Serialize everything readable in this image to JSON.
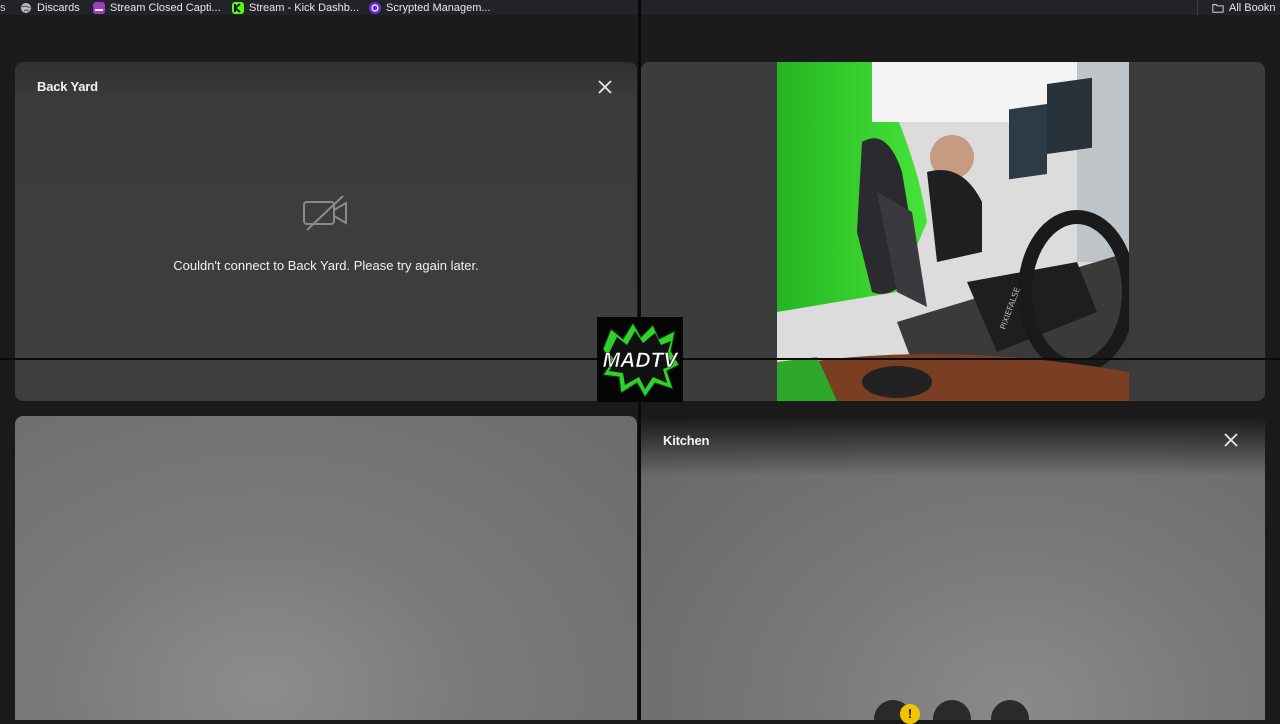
{
  "bookmarks": {
    "items": [
      {
        "label": "Discards",
        "icon": "globe-icon"
      },
      {
        "label": "Stream Closed Capti...",
        "icon": "captions-icon"
      },
      {
        "label": "Stream - Kick Dashb...",
        "icon": "kick-icon"
      },
      {
        "label": "Scrypted Managem...",
        "icon": "scrypted-icon"
      }
    ],
    "all_label": "All Bookn"
  },
  "panels": {
    "back_yard": {
      "title": "Back Yard",
      "error": "Couldn't connect to Back Yard. Please try again later."
    },
    "kitchen": {
      "title": "Kitchen",
      "warning_badge": "!"
    }
  },
  "logo": {
    "text": "MADTV"
  },
  "feed_sign": "PIXIEFALSE",
  "colors": {
    "accent_green": "#2fd12a",
    "kick_green": "#53fc18",
    "warning_yellow": "#f2c400"
  }
}
